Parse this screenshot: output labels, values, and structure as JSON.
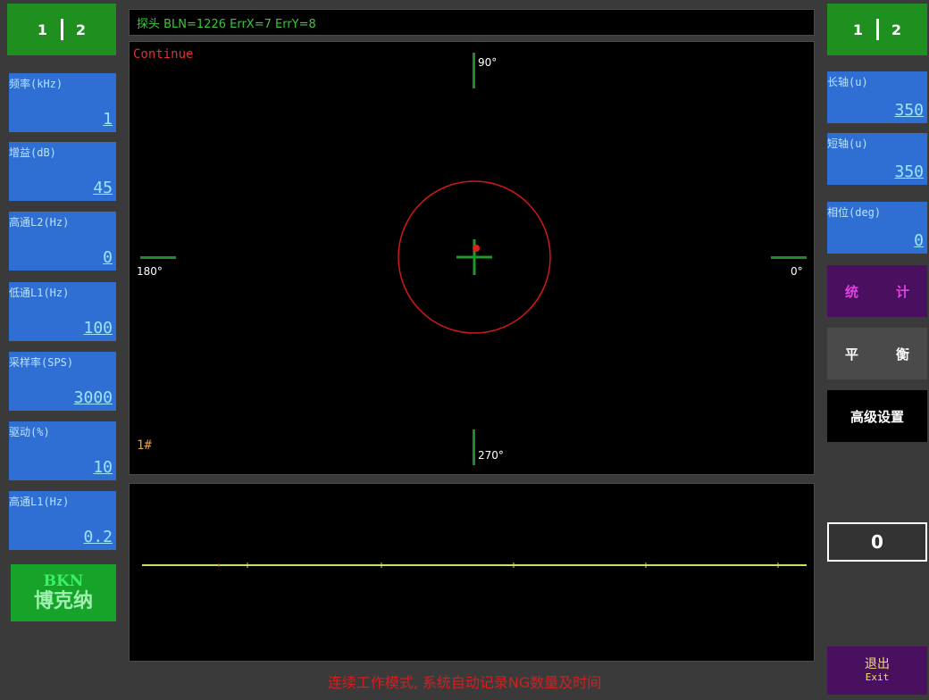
{
  "left_tabs": [
    "1",
    "2"
  ],
  "right_tabs": [
    "1",
    "2"
  ],
  "left_params": [
    {
      "label": "频率(kHz)",
      "value": "1"
    },
    {
      "label": "增益(dB)",
      "value": "45"
    },
    {
      "label": "高通L2(Hz)",
      "value": "0"
    },
    {
      "label": "低通L1(Hz)",
      "value": "100"
    },
    {
      "label": "采样率(SPS)",
      "value": "3000"
    },
    {
      "label": "驱动(%)",
      "value": "10"
    },
    {
      "label": "高通L1(Hz)",
      "value": "0.2"
    }
  ],
  "logo": {
    "line1": "BKN",
    "line2": "博克纳"
  },
  "right_params": [
    {
      "label": "长轴(u)",
      "value": "350"
    },
    {
      "label": "短轴(u)",
      "value": "350"
    },
    {
      "label": "相位(deg)",
      "value": "0"
    }
  ],
  "buttons": {
    "stats": [
      "统",
      "计"
    ],
    "balance": [
      "平",
      "衡"
    ],
    "advanced": "高级设置",
    "counter": "0",
    "exit_cn": "退出",
    "exit_en": "Exit"
  },
  "header": "探头 BLN=1226 ErrX=7 ErrY=8",
  "scope": {
    "mode": "Continue",
    "angle_90": "90°",
    "angle_180": "180°",
    "angle_0": "0°",
    "angle_270": "270°",
    "channel": "1#"
  },
  "status_text": "连续工作模式, 系统自动记录NG数量及时间",
  "colors": {
    "tab_green": "#1f8f1f",
    "param_blue": "#2f6fd4",
    "ring_red": "#d01818",
    "stats_purple": "#4a1060",
    "trace_yellow": "#c8e060"
  }
}
